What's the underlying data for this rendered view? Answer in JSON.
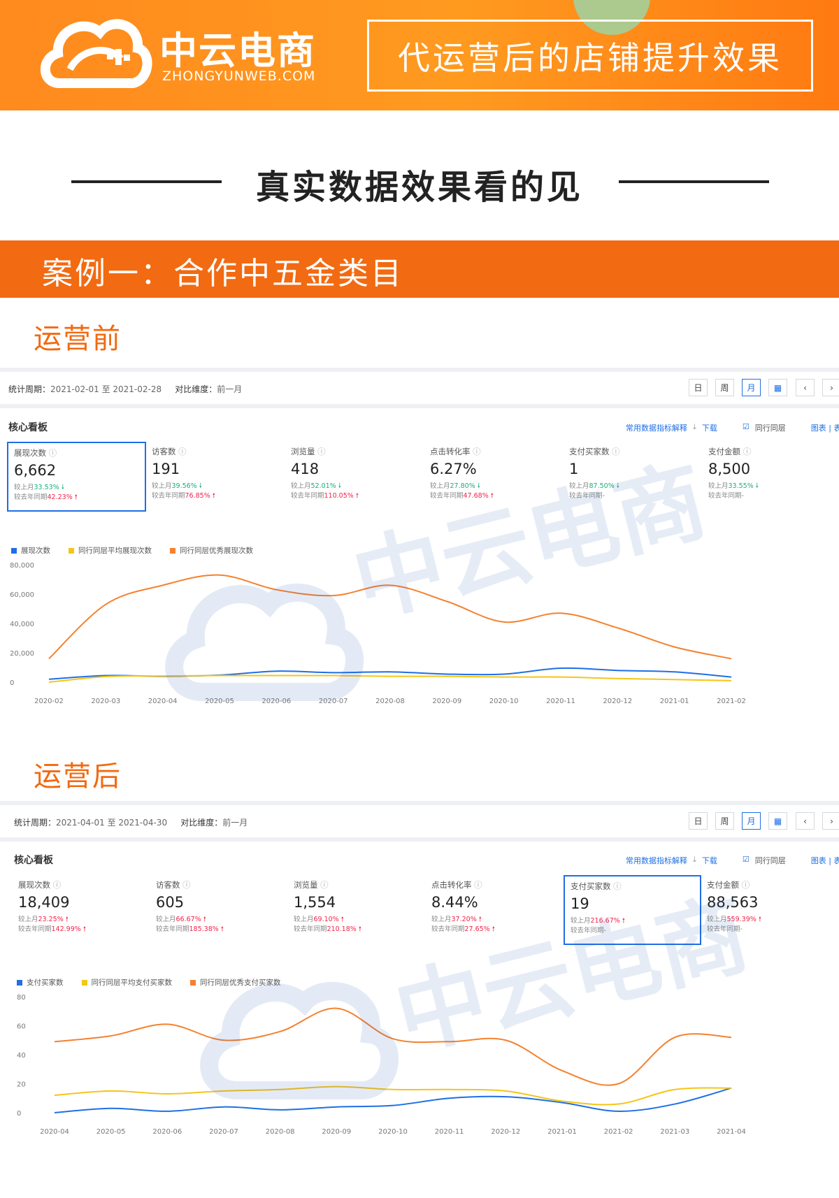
{
  "header": {
    "brand_cn": "中云电商",
    "brand_en": "ZHONGYUNWEB.COM",
    "slogan": "代运营后的店铺提升效果"
  },
  "section_title": "真实数据效果看的见",
  "case": {
    "title": "案例一：合作中五金类目"
  },
  "colors": {
    "orange": "#f26a11",
    "blue": "#1f6fe5",
    "yellow": "#f5c518",
    "line_orange": "#f5812e"
  },
  "panels": [
    {
      "stage_label": "运营前",
      "period_label": "统计周期：",
      "period_value": "2021-02-01 至 2021-02-28",
      "compare_label": "对比维度：",
      "compare_value": "前一月",
      "buttons": [
        "日",
        "周",
        "月"
      ],
      "board_title": "核心看板",
      "link_glossary": "常用数据指标解释",
      "link_download": "下载",
      "link_peer": "同行同层",
      "link_view": "图表 | 表格",
      "kpis": [
        {
          "label": "展现次数",
          "value": "6,662",
          "mom_prefix": "较上月",
          "mom": "33.53%",
          "mom_dir": "down",
          "yoy_prefix": "较去年同期",
          "yoy": "42.23%",
          "yoy_dir": "up",
          "selected": true
        },
        {
          "label": "访客数",
          "value": "191",
          "mom_prefix": "较上月",
          "mom": "39.56%",
          "mom_dir": "down",
          "yoy_prefix": "较去年同期",
          "yoy": "76.85%",
          "yoy_dir": "up",
          "selected": false
        },
        {
          "label": "浏览量",
          "value": "418",
          "mom_prefix": "较上月",
          "mom": "52.01%",
          "mom_dir": "down",
          "yoy_prefix": "较去年同期",
          "yoy": "110.05%",
          "yoy_dir": "up",
          "selected": false
        },
        {
          "label": "点击转化率",
          "value": "6.27%",
          "mom_prefix": "较上月",
          "mom": "27.80%",
          "mom_dir": "down",
          "yoy_prefix": "较去年同期",
          "yoy": "47.68%",
          "yoy_dir": "up",
          "selected": false
        },
        {
          "label": "支付买家数",
          "value": "1",
          "mom_prefix": "较上月",
          "mom": "87.50%",
          "mom_dir": "down",
          "yoy_prefix": "较去年同期",
          "yoy": "-",
          "yoy_dir": "none",
          "selected": false
        },
        {
          "label": "支付金额",
          "value": "8,500",
          "mom_prefix": "较上月",
          "mom": "33.55%",
          "mom_dir": "down",
          "yoy_prefix": "较去年同期",
          "yoy": "-",
          "yoy_dir": "none",
          "selected": false
        }
      ]
    },
    {
      "stage_label": "运营后",
      "period_label": "统计周期：",
      "period_value": "2021-04-01 至 2021-04-30",
      "compare_label": "对比维度：",
      "compare_value": "前一月",
      "buttons": [
        "日",
        "周",
        "月"
      ],
      "board_title": "核心看板",
      "link_glossary": "常用数据指标解释",
      "link_download": "下载",
      "link_peer": "同行同层",
      "link_view": "图表 | 表格",
      "kpis": [
        {
          "label": "展现次数",
          "value": "18,409",
          "mom_prefix": "较上月",
          "mom": "23.25%",
          "mom_dir": "up",
          "yoy_prefix": "较去年同期",
          "yoy": "142.99%",
          "yoy_dir": "up",
          "selected": false
        },
        {
          "label": "访客数",
          "value": "605",
          "mom_prefix": "较上月",
          "mom": "66.67%",
          "mom_dir": "up",
          "yoy_prefix": "较去年同期",
          "yoy": "185.38%",
          "yoy_dir": "up",
          "selected": false
        },
        {
          "label": "浏览量",
          "value": "1,554",
          "mom_prefix": "较上月",
          "mom": "69.10%",
          "mom_dir": "up",
          "yoy_prefix": "较去年同期",
          "yoy": "210.18%",
          "yoy_dir": "up",
          "selected": false
        },
        {
          "label": "点击转化率",
          "value": "8.44%",
          "mom_prefix": "较上月",
          "mom": "37.20%",
          "mom_dir": "up",
          "yoy_prefix": "较去年同期",
          "yoy": "27.65%",
          "yoy_dir": "up",
          "selected": false
        },
        {
          "label": "支付买家数",
          "value": "19",
          "mom_prefix": "较上月",
          "mom": "216.67%",
          "mom_dir": "up",
          "yoy_prefix": "较去年同期",
          "yoy": "-",
          "yoy_dir": "none",
          "selected": true
        },
        {
          "label": "支付金额",
          "value": "88,563",
          "mom_prefix": "较上月",
          "mom": "559.39%",
          "mom_dir": "up",
          "yoy_prefix": "较去年同期",
          "yoy": "-",
          "yoy_dir": "none",
          "selected": false
        }
      ]
    }
  ],
  "chart_data": [
    {
      "type": "line",
      "x": [
        "2020-02",
        "2020-03",
        "2020-04",
        "2020-05",
        "2020-06",
        "2020-07",
        "2020-08",
        "2020-09",
        "2020-10",
        "2020-11",
        "2020-12",
        "2021-01",
        "2021-02"
      ],
      "ylim": [
        0,
        80000
      ],
      "yticks": [
        "80,000",
        "60,000",
        "40,000",
        "20,000",
        "0"
      ],
      "ytick_values": [
        80000,
        60000,
        40000,
        20000,
        0
      ],
      "series": [
        {
          "name": "展现次数",
          "color": "#1f6fe5",
          "values": [
            2000,
            4500,
            4000,
            4800,
            7500,
            6500,
            7000,
            5500,
            5500,
            9500,
            8000,
            7000,
            3500
          ]
        },
        {
          "name": "同行同层平均展现次数",
          "color": "#f5c518",
          "values": [
            0,
            3800,
            4200,
            4500,
            4500,
            4500,
            4000,
            4000,
            3500,
            3500,
            2500,
            1800,
            1000
          ]
        },
        {
          "name": "同行同层优秀展现次数",
          "color": "#f5812e",
          "values": [
            16000,
            53000,
            66000,
            73000,
            63000,
            59000,
            66000,
            55000,
            41000,
            47000,
            37000,
            24000,
            16000
          ]
        }
      ]
    },
    {
      "type": "line",
      "x": [
        "2020-04",
        "2020-05",
        "2020-06",
        "2020-07",
        "2020-08",
        "2020-09",
        "2020-10",
        "2020-11",
        "2020-12",
        "2021-01",
        "2021-02",
        "2021-03",
        "2021-04"
      ],
      "ylim": [
        0,
        80
      ],
      "yticks": [
        "80",
        "60",
        "40",
        "20",
        "0"
      ],
      "ytick_values": [
        80,
        60,
        40,
        20,
        0
      ],
      "series": [
        {
          "name": "支付买家数",
          "color": "#1f6fe5",
          "values": [
            0,
            3,
            1,
            4,
            2,
            4,
            5,
            10,
            11,
            7,
            1,
            6,
            17
          ]
        },
        {
          "name": "同行同层平均支付买家数",
          "color": "#f5c518",
          "values": [
            12,
            15,
            13,
            15,
            16,
            18,
            16,
            16,
            15,
            8,
            6,
            16,
            17
          ]
        },
        {
          "name": "同行同层优秀支付买家数",
          "color": "#f5812e",
          "values": [
            49,
            53,
            61,
            50,
            56,
            72,
            51,
            49,
            50,
            29,
            20,
            52,
            52
          ]
        }
      ]
    }
  ]
}
